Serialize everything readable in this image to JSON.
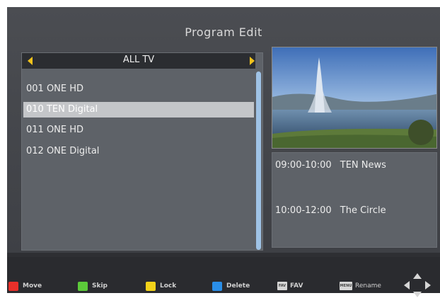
{
  "title": "Program Edit",
  "list": {
    "header": "ALL TV",
    "channels": [
      {
        "label": "001 ONE HD"
      },
      {
        "label": "010 TEN Digital"
      },
      {
        "label": "011 ONE HD"
      },
      {
        "label": "012 ONE Digital"
      }
    ],
    "selected_index": 1
  },
  "epg": [
    {
      "time": "09:00-10:00",
      "program": "TEN News"
    },
    {
      "time": "10:00-12:00",
      "program": "The Circle"
    }
  ],
  "legend": {
    "move": "Move",
    "skip": "Skip",
    "lock": "Lock",
    "delete": "Delete",
    "fav": "FAV",
    "rename": "Rename",
    "fav_key": "FAV",
    "rename_key": "MENU"
  },
  "colors": {
    "move": "#e8302a",
    "skip": "#5cc93a",
    "lock": "#f2d21a",
    "delete": "#2a8ee8",
    "accent_arrow": "#f0c21c"
  },
  "icons": {
    "nav": "dpad-icon",
    "arrow_left": "triangle-left-icon",
    "arrow_right": "triangle-right-icon"
  }
}
